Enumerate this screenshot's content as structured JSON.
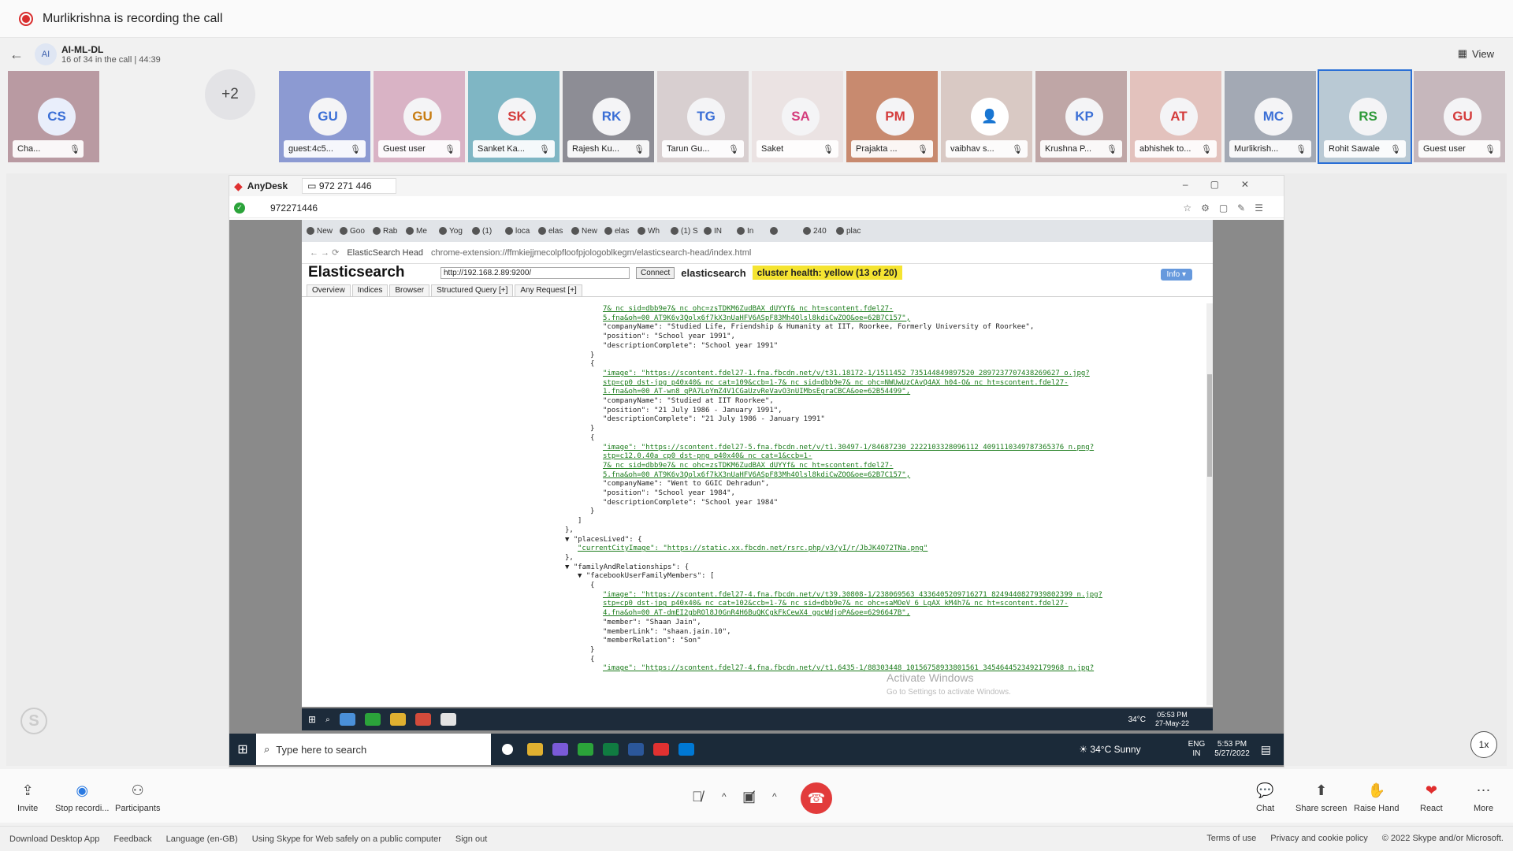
{
  "recording": {
    "text": "Murlikrishna is recording the call"
  },
  "call": {
    "group_initials": "AI",
    "group_name": "AI-ML-DL",
    "subtitle": "16 of 34 in the call | 44:39",
    "view_label": "View"
  },
  "participants": {
    "first": {
      "initials": "CS",
      "name": "Cha...",
      "color": "#3b6fd6",
      "bg": "#b99aa2"
    },
    "more_count": "+2",
    "tiles": [
      {
        "initials": "GU",
        "name": "guest:4c5...",
        "color": "#3b6fd6",
        "bg": "#8c9ad2"
      },
      {
        "initials": "GU",
        "name": "Guest user",
        "color": "#c77c12",
        "bg": "#d9b3c5"
      },
      {
        "initials": "SK",
        "name": "Sanket Ka...",
        "color": "#d43c3c",
        "bg": "#7fb6c4"
      },
      {
        "initials": "RK",
        "name": "Rajesh Ku...",
        "color": "#3b6fd6",
        "bg": "#8d8d95"
      },
      {
        "initials": "TG",
        "name": "Tarun Gu...",
        "color": "#3b6fd6",
        "bg": "#d8cfd0"
      },
      {
        "initials": "SA",
        "name": "Saket",
        "color": "#d43c7c",
        "bg": "#ebe3e3"
      },
      {
        "initials": "PM",
        "name": "Prajakta ...",
        "color": "#d43c3c",
        "bg": "#c88a6f"
      },
      {
        "initials": "",
        "name": "vaibhav s...",
        "color": "#333",
        "bg": "#d9c9c4"
      },
      {
        "initials": "KP",
        "name": "Krushna P...",
        "color": "#3b6fd6",
        "bg": "#bfa6a6"
      },
      {
        "initials": "AT",
        "name": "abhishek to...",
        "color": "#d43c3c",
        "bg": "#e3c2bd"
      },
      {
        "initials": "MC",
        "name": "Murlikrish...",
        "color": "#3b6fd6",
        "bg": "#a3a9b4"
      },
      {
        "initials": "RS",
        "name": "Rohit Sawale",
        "color": "#2f9a3a",
        "bg": "#b9c9d4"
      },
      {
        "initials": "GU",
        "name": "Guest user",
        "color": "#d43c3c",
        "bg": "#c6b7bc"
      }
    ]
  },
  "anydesk": {
    "app": "AnyDesk",
    "session_tab": "972 271 446",
    "address": "972271446"
  },
  "chrome": {
    "tabs": [
      "New",
      "Goo",
      "Rab",
      "Me",
      "Yog",
      "(1)",
      "loca",
      "elas",
      "New",
      "elas",
      "Wh",
      "(1) S",
      "IN",
      "In",
      "",
      "240",
      "plac"
    ],
    "ext_name": "ElasticSearch Head",
    "url": "chrome-extension://ffmkiejjmecolpfloofpjologoblkegm/elasticsearch-head/index.html"
  },
  "es": {
    "title": "Elasticsearch",
    "url": "http://192.168.2.89:9200/",
    "connect": "Connect",
    "cluster": "elasticsearch",
    "health": "cluster health: yellow (13 of 20)",
    "info": "Info",
    "tabs": [
      "Overview",
      "Indices",
      "Browser",
      "Structured Query [+]",
      "Any Request [+]"
    ]
  },
  "json_lines": [
    {
      "t": "7&_nc_sid=dbb9e7&_nc_ohc=zsTDKM6ZudBAX_dUYYf&_nc_ht=scontent.fdel27-",
      "lnk": true
    },
    {
      "t": "5.fna&oh=00_AT9K6v3Qolx6f7kX3nUaHFV6ASpF83Mh4Olsl8kdiCwZOO&oe=62B7C157\",",
      "lnk": true
    },
    {
      "t": "\"companyName\": \"Studied Life, Friendship & Humanity at IIT, Roorkee, Formerly University of Roorkee\",",
      "lnk": false
    },
    {
      "t": "\"position\": \"School year 1991\",",
      "lnk": false
    },
    {
      "t": "\"descriptionComplete\": \"School year 1991\"",
      "lnk": false
    },
    {
      "t": "}",
      "lnk": false
    },
    {
      "t": "{",
      "lnk": false
    },
    {
      "t": "\"image\": \"https://scontent.fdel27-1.fna.fbcdn.net/v/t31.18172-1/1511452_735144849897520_2897237707438269627_o.jpg?",
      "lnk": true
    },
    {
      "t": "stp=cp0_dst-jpg_p40x40&_nc_cat=109&ccb=1-7&_nc_sid=dbb9e7&_nc_ohc=NWUwUzCAvQ4AX_h04-O&_nc_ht=scontent.fdel27-",
      "lnk": true
    },
    {
      "t": "1.fna&oh=00_AT-wn8_qPA7LoYmZ4V1CGaUzvReVavO3nUIMbsEgraCBCA&oe=62B54499\",",
      "lnk": true
    },
    {
      "t": "\"companyName\": \"Studied at IIT Roorkee\",",
      "lnk": false
    },
    {
      "t": "\"position\": \"21 July 1986 - January 1991\",",
      "lnk": false
    },
    {
      "t": "\"descriptionComplete\": \"21 July 1986 - January 1991\"",
      "lnk": false
    },
    {
      "t": "}",
      "lnk": false
    },
    {
      "t": "{",
      "lnk": false
    },
    {
      "t": "\"image\": \"https://scontent.fdel27-5.fna.fbcdn.net/v/t1.30497-1/84687230_2222103328096112_4091110349787365376_n.png?",
      "lnk": true
    },
    {
      "t": "stp=c12.0.40a_cp0_dst-png_p40x40&_nc_cat=1&ccb=1-",
      "lnk": true
    },
    {
      "t": "7&_nc_sid=dbb9e7&_nc_ohc=zsTDKM6ZudBAX_dUYYf&_nc_ht=scontent.fdel27-",
      "lnk": true
    },
    {
      "t": "5.fna&oh=00_AT9K6v3Qolx6f7kX3nUaHFV6ASpF83Mh4Olsl8kdiCwZOO&oe=62B7C157\",",
      "lnk": true
    },
    {
      "t": "\"companyName\": \"Went to GGIC Dehradun\",",
      "lnk": false
    },
    {
      "t": "\"position\": \"School year 1984\",",
      "lnk": false
    },
    {
      "t": "\"descriptionComplete\": \"School year 1984\"",
      "lnk": false
    },
    {
      "t": "}",
      "lnk": false
    },
    {
      "t": "]",
      "lnk": false
    },
    {
      "t": "},",
      "lnk": false
    },
    {
      "t": "▼ \"placesLived\": {",
      "lnk": false
    },
    {
      "t": "\"currentCityImage\": \"https://static.xx.fbcdn.net/rsrc.php/v3/yI/r/JbJK4O72TNa.png\"",
      "lnk": true
    },
    {
      "t": "},",
      "lnk": false
    },
    {
      "t": "▼ \"familyAndRelationships\": {",
      "lnk": false
    },
    {
      "t": "▼ \"facebookUserFamilyMembers\": [",
      "lnk": false
    },
    {
      "t": "{",
      "lnk": false
    },
    {
      "t": "\"image\": \"https://scontent.fdel27-4.fna.fbcdn.net/v/t39.30808-1/238069563_4336405209716271_8249440827939802399_n.jpg?",
      "lnk": true
    },
    {
      "t": "stp=cp0_dst-jpg_p40x40&_nc_cat=102&ccb=1-7&_nc_sid=dbb9e7&_nc_ohc=saMOeV_6_LgAX_kM4h7&_nc_ht=scontent.fdel27-",
      "lnk": true
    },
    {
      "t": "4.fna&oh=00_AT-dmEI2gbROl8J0GnR4H6BuQKCgkFkCewX4_ggcWdjoPA&oe=6296647B\",",
      "lnk": true
    },
    {
      "t": "\"member\": \"Shaan Jain\",",
      "lnk": false
    },
    {
      "t": "\"memberLink\": \"shaan.jain.10\",",
      "lnk": false
    },
    {
      "t": "\"memberRelation\": \"Son\"",
      "lnk": false
    },
    {
      "t": "}",
      "lnk": false
    },
    {
      "t": "{",
      "lnk": false
    },
    {
      "t": "\"image\": \"https://scontent.fdel27-4.fna.fbcdn.net/v/t1.6435-1/88303448_10156758933801561_3454644523492179968_n.jpg?",
      "lnk": true
    }
  ],
  "activate": {
    "title": "Activate Windows",
    "sub": "Go to Settings to activate Windows."
  },
  "remote_taskbar": {
    "weather": "34°C",
    "time": "05:53 PM",
    "date": "27-May-22"
  },
  "local_taskbar": {
    "search_placeholder": "Type here to search",
    "weather": "34°C  Sunny",
    "lang1": "ENG",
    "lang2": "IN",
    "time": "5:53 PM",
    "date": "5/27/2022"
  },
  "speed": "1x",
  "controls": {
    "invite": "Invite",
    "stop_recording": "Stop recordi...",
    "participants": "Participants",
    "chat": "Chat",
    "share_screen": "Share screen",
    "raise_hand": "Raise Hand",
    "react": "React",
    "more": "More"
  },
  "footer": {
    "left": [
      "Download Desktop App",
      "Feedback",
      "Language (en-GB)",
      "Using Skype for Web safely on a public computer",
      "Sign out"
    ],
    "right": [
      "Terms of use",
      "Privacy and cookie policy",
      "© 2022 Skype and/or Microsoft."
    ]
  }
}
